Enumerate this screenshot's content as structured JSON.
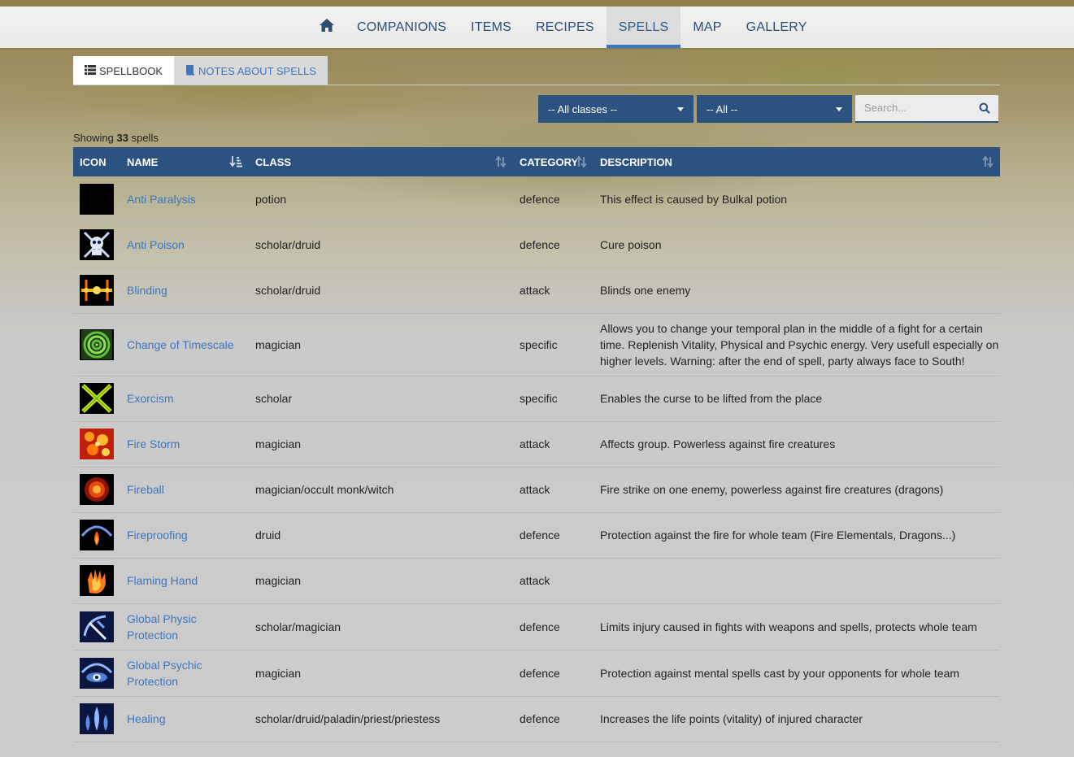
{
  "nav": {
    "home_icon": "home-icon",
    "items": [
      {
        "label": "COMPANIONS"
      },
      {
        "label": "ITEMS"
      },
      {
        "label": "RECIPES"
      },
      {
        "label": "SPELLS"
      },
      {
        "label": "MAP"
      },
      {
        "label": "GALLERY"
      }
    ],
    "active": "SPELLS"
  },
  "subtabs": [
    {
      "label": "SPELLBOOK",
      "icon": "list-icon",
      "active": true
    },
    {
      "label": "NOTES ABOUT SPELLS",
      "icon": "book-icon",
      "active": false
    }
  ],
  "filters": {
    "class_select": "-- All classes --",
    "category_select": "-- All --",
    "search_placeholder": "Search..."
  },
  "showing": {
    "prefix": "Showing",
    "count": "33",
    "suffix": "spells"
  },
  "table": {
    "headers": [
      "ICON",
      "NAME",
      "CLASS",
      "CATEGORY",
      "DESCRIPTION"
    ],
    "rows": [
      {
        "icon": "black-square-icon",
        "name": "Anti Paralysis",
        "class": "potion",
        "category": "defence",
        "description": "This effect is caused by Bulkal potion"
      },
      {
        "icon": "skull-cross-icon",
        "name": "Anti Poison",
        "class": "scholar/druid",
        "category": "defence",
        "description": "Cure poison"
      },
      {
        "icon": "flash-icon",
        "name": "Blinding",
        "class": "scholar/druid",
        "category": "attack",
        "description": "Blinds one enemy"
      },
      {
        "icon": "spiral-icon",
        "name": "Change of Timescale",
        "class": "magician",
        "category": "specific",
        "description": "Allows you to change your temporal plan in the middle of a fight for a certain time. Replenish Vitality, Physical and Psychic energy. Very usefull especially on higher levels. Warning: after the end of spell, party always face to South!"
      },
      {
        "icon": "cross-x-icon",
        "name": "Exorcism",
        "class": "scholar",
        "category": "specific",
        "description": "Enables the curse to be lifted from the place"
      },
      {
        "icon": "firestorm-icon",
        "name": "Fire Storm",
        "class": "magician",
        "category": "attack",
        "description": "Affects group. Powerless against fire creatures"
      },
      {
        "icon": "fireball-icon",
        "name": "Fireball",
        "class": "magician/occult monk/witch",
        "category": "attack",
        "description": "Fire strike on one enemy, powerless against fire creatures (dragons)"
      },
      {
        "icon": "fire-dome-icon",
        "name": "Fireproofing",
        "class": "druid",
        "category": "defence",
        "description": "Protection against the fire for whole team (Fire Elementals, Dragons...)"
      },
      {
        "icon": "flaming-hand-icon",
        "name": "Flaming Hand",
        "class": "magician",
        "category": "attack",
        "description": ""
      },
      {
        "icon": "physic-shield-icon",
        "name": "Global Physic Protection",
        "class": "scholar/magician",
        "category": "defence",
        "description": "Limits injury caused in fights with weapons and spells, protects whole team"
      },
      {
        "icon": "psychic-eye-icon",
        "name": "Global Psychic Protection",
        "class": "magician",
        "category": "defence",
        "description": "Protection against mental spells cast by your opponents for whole team"
      },
      {
        "icon": "healing-drops-icon",
        "name": "Healing",
        "class": "scholar/druid/paladin/priest/priestess",
        "category": "defence",
        "description": "Increases the life points (vitality) of injured character"
      }
    ]
  }
}
